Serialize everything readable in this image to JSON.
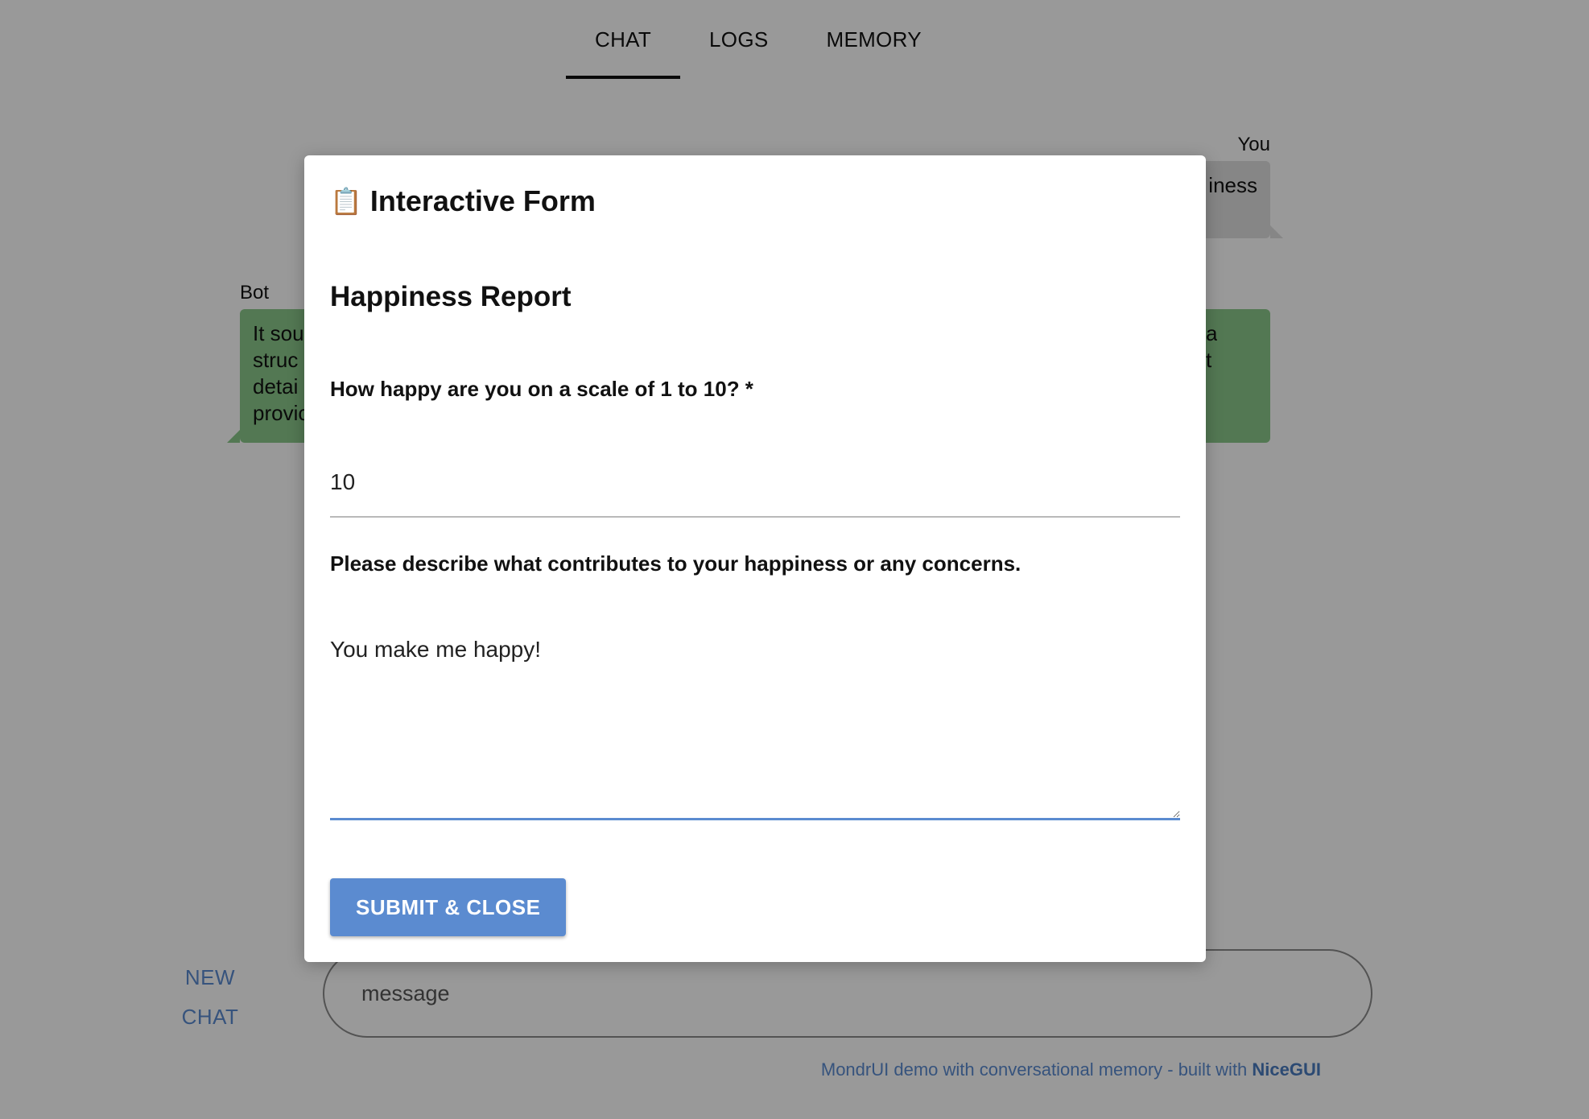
{
  "tabs": [
    {
      "label": "CHAT",
      "active": true
    },
    {
      "label": "LOGS",
      "active": false
    },
    {
      "label": "MEMORY",
      "active": false
    }
  ],
  "messages": {
    "you": {
      "author": "You",
      "text": "iness"
    },
    "bot": {
      "author": "Bot",
      "text_left": "It sou\nstruc\ndetai\nprovic",
      "text_right": "a\nt"
    }
  },
  "chat_input": {
    "new_chat_label": "NEW CHAT",
    "placeholder": "message"
  },
  "footer": {
    "text": "MondrUI demo with conversational memory - built with ",
    "brand": "NiceGUI"
  },
  "dialog": {
    "icon": "📋",
    "title": "Interactive Form",
    "form_title": "Happiness Report",
    "field_1": {
      "label": "How happy are you on a scale of 1 to 10? *",
      "value": "10"
    },
    "field_2": {
      "label": "Please describe what contributes to your happiness or any concerns.",
      "value": "You make me happy!"
    },
    "submit_label": "SUBMIT & CLOSE"
  },
  "colors": {
    "accent": "#5b8bd0",
    "bot_bubble": "#8bc98a",
    "user_bubble": "#e0e0e0",
    "overlay": "rgba(0,0,0,0.4)"
  }
}
